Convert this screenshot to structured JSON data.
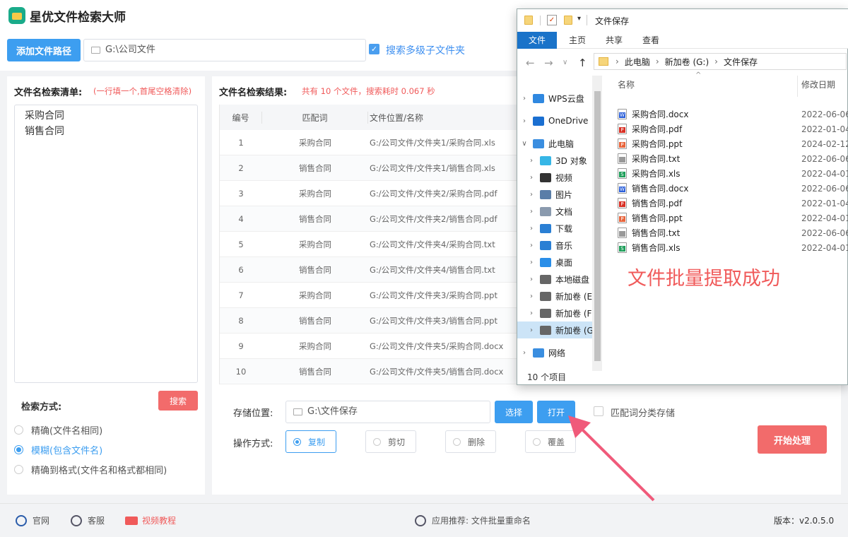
{
  "app": {
    "title": "星优文件检索大师"
  },
  "toolbar": {
    "add_path_label": "添加文件路径",
    "path_value": "G:\\公司文件",
    "subfolder_label": "搜索多级子文件夹"
  },
  "left": {
    "list_title": "文件名检索清单:",
    "list_hint": "(一行填一个,首尾空格清除)",
    "names": [
      "采购合同",
      "销售合同"
    ],
    "search_label": "搜索",
    "mode_label": "检索方式:",
    "modes": [
      "精确(文件名相同)",
      "模糊(包含文件名)",
      "精确到格式(文件名和格式都相同)"
    ],
    "selected_mode": 1
  },
  "results": {
    "title": "文件名检索结果:",
    "info": "共有 10 个文件，搜索耗时 0.067 秒",
    "headers": [
      "编号",
      "匹配词",
      "文件位置/名称"
    ],
    "rows": [
      [
        "1",
        "采购合同",
        "G:/公司文件/文件夹1/采购合同.xls"
      ],
      [
        "2",
        "销售合同",
        "G:/公司文件/文件夹1/销售合同.xls"
      ],
      [
        "3",
        "采购合同",
        "G:/公司文件/文件夹2/采购合同.pdf"
      ],
      [
        "4",
        "销售合同",
        "G:/公司文件/文件夹2/销售合同.pdf"
      ],
      [
        "5",
        "采购合同",
        "G:/公司文件/文件夹4/采购合同.txt"
      ],
      [
        "6",
        "销售合同",
        "G:/公司文件/文件夹4/销售合同.txt"
      ],
      [
        "7",
        "采购合同",
        "G:/公司文件/文件夹3/采购合同.ppt"
      ],
      [
        "8",
        "销售合同",
        "G:/公司文件/文件夹3/销售合同.ppt"
      ],
      [
        "9",
        "采购合同",
        "G:/公司文件/文件夹5/采购合同.docx"
      ],
      [
        "10",
        "销售合同",
        "G:/公司文件/文件夹5/销售合同.docx"
      ]
    ]
  },
  "controls": {
    "save_label": "存储位置:",
    "save_value": "G:\\文件保存",
    "choose_label": "选择",
    "open_label": "打开",
    "classify_label": "匹配词分类存储",
    "op_label": "操作方式:",
    "ops": [
      "复制",
      "剪切",
      "删除",
      "覆盖"
    ],
    "selected_op": 0,
    "start_label": "开始处理"
  },
  "footer": {
    "site": "官网",
    "service": "客服",
    "video": "视频教程",
    "recommend": "应用推荐:  文件批量重命名",
    "version": "版本：v2.0.5.0"
  },
  "explorer": {
    "title": "文件保存",
    "tabs": [
      "文件",
      "主页",
      "共享",
      "查看"
    ],
    "breadcrumb": [
      "此电脑",
      "新加卷 (G:)",
      "文件保存"
    ],
    "nav": [
      {
        "label": "WPS云盘",
        "icon": "cloud-icon",
        "color": "#2f88e0"
      },
      {
        "label": "OneDrive",
        "icon": "onedrive-icon",
        "color": "#1a6fd1"
      },
      {
        "label": "此电脑",
        "icon": "computer-icon",
        "color": "#3a8ee0"
      },
      {
        "label": "3D 对象",
        "icon": "cube-icon",
        "color": "#36b6e6"
      },
      {
        "label": "视频",
        "icon": "video-icon",
        "color": "#333"
      },
      {
        "label": "图片",
        "icon": "picture-icon",
        "color": "#5a7ea8"
      },
      {
        "label": "文档",
        "icon": "document-icon",
        "color": "#8a9aae"
      },
      {
        "label": "下载",
        "icon": "download-icon",
        "color": "#2a7fd4"
      },
      {
        "label": "音乐",
        "icon": "music-icon",
        "color": "#2a7fd4"
      },
      {
        "label": "桌面",
        "icon": "desktop-icon",
        "color": "#2a8ee8"
      },
      {
        "label": "本地磁盘",
        "icon": "disk-icon",
        "color": "#666"
      },
      {
        "label": "新加卷 (E",
        "icon": "drive-icon",
        "color": "#666"
      },
      {
        "label": "新加卷 (F",
        "icon": "drive-icon",
        "color": "#666"
      },
      {
        "label": "新加卷 (G",
        "icon": "drive-icon",
        "color": "#666"
      },
      {
        "label": "网络",
        "icon": "network-icon",
        "color": "#3a8ee0"
      }
    ],
    "col_name": "名称",
    "col_date": "修改日期",
    "files": [
      {
        "name": "采购合同.docx",
        "date": "2022-06-06",
        "type": "W",
        "color": "#2b5fd9"
      },
      {
        "name": "采购合同.pdf",
        "date": "2022-01-04",
        "type": "P",
        "color": "#d93025"
      },
      {
        "name": "采购合同.ppt",
        "date": "2024-02-12",
        "type": "P",
        "color": "#e8643b"
      },
      {
        "name": "采购合同.txt",
        "date": "2022-06-06",
        "type": "",
        "color": "#999"
      },
      {
        "name": "采购合同.xls",
        "date": "2022-04-01",
        "type": "S",
        "color": "#1e9e5a"
      },
      {
        "name": "销售合同.docx",
        "date": "2022-06-06",
        "type": "W",
        "color": "#2b5fd9"
      },
      {
        "name": "销售合同.pdf",
        "date": "2022-01-04",
        "type": "P",
        "color": "#d93025"
      },
      {
        "name": "销售合同.ppt",
        "date": "2022-04-01",
        "type": "P",
        "color": "#e8643b"
      },
      {
        "name": "销售合同.txt",
        "date": "2022-06-06",
        "type": "",
        "color": "#999"
      },
      {
        "name": "销售合同.xls",
        "date": "2022-04-01",
        "type": "S",
        "color": "#1e9e5a"
      }
    ],
    "status": "10 个项目"
  },
  "annotation": {
    "text": "文件批量提取成功"
  }
}
